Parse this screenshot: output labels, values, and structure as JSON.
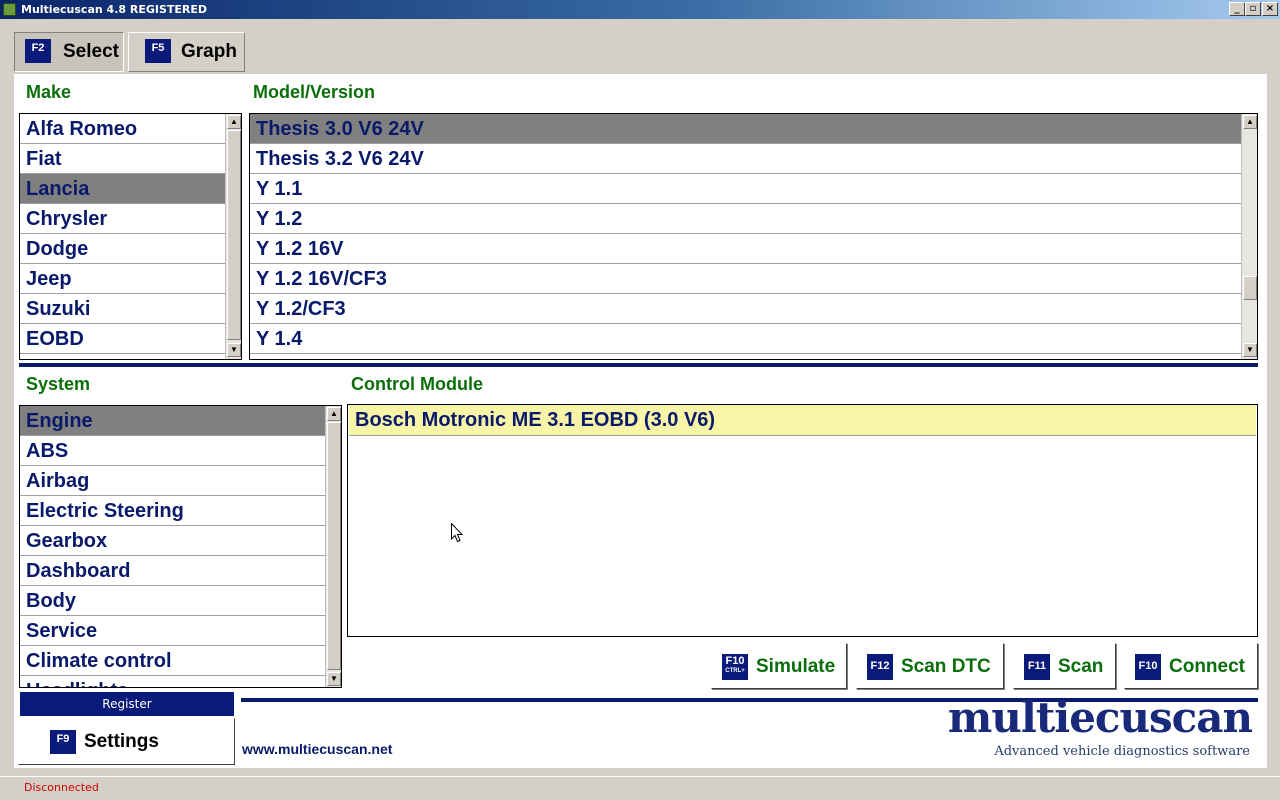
{
  "window": {
    "title": "Multiecuscan 4.8 REGISTERED",
    "minimize": "_",
    "maximize": "▫",
    "close": "×"
  },
  "tabs": [
    {
      "key": "F2",
      "label": "Select",
      "active": true
    },
    {
      "key": "F5",
      "label": "Graph",
      "active": false
    }
  ],
  "make": {
    "label": "Make",
    "items": [
      "Alfa Romeo",
      "Fiat",
      "Lancia",
      "Chrysler",
      "Dodge",
      "Jeep",
      "Suzuki",
      "EOBD"
    ],
    "selected": "Lancia"
  },
  "model": {
    "label": "Model/Version",
    "items": [
      "Thesis 3.0 V6 24V",
      "Thesis 3.2 V6 24V",
      "Y 1.1",
      "Y 1.2",
      "Y 1.2 16V",
      "Y 1.2 16V/CF3",
      "Y 1.2/CF3",
      "Y 1.4"
    ],
    "selected": "Thesis 3.0 V6 24V"
  },
  "system": {
    "label": "System",
    "items": [
      "Engine",
      "ABS",
      "Airbag",
      "Electric Steering",
      "Gearbox",
      "Dashboard",
      "Body",
      "Service",
      "Climate control",
      "Headlights"
    ],
    "selected": "Engine"
  },
  "control_module": {
    "label": "Control Module",
    "items": [
      "Bosch Motronic ME 3.1 EOBD (3.0 V6)"
    ]
  },
  "actions": {
    "simulate": {
      "key": "F10",
      "sub": "CTRL+",
      "label": "Simulate"
    },
    "scan_dtc": {
      "key": "F12",
      "label": "Scan DTC"
    },
    "scan": {
      "key": "F11",
      "label": "Scan"
    },
    "connect": {
      "key": "F10",
      "label": "Connect"
    }
  },
  "register_label": "Register",
  "settings": {
    "key": "F9",
    "label": "Settings"
  },
  "website": "www.multiecuscan.net",
  "logo": {
    "name": "multiecuscan",
    "tagline": "Advanced vehicle diagnostics software"
  },
  "status": "Disconnected",
  "colors": {
    "fkey_bg": "#0a1a7a",
    "label_green": "#0a6e0a",
    "text_navy": "#0a1a6a",
    "selected_row": "#808080",
    "module_highlight": "#f8f4a8",
    "status_red": "#d00000"
  }
}
